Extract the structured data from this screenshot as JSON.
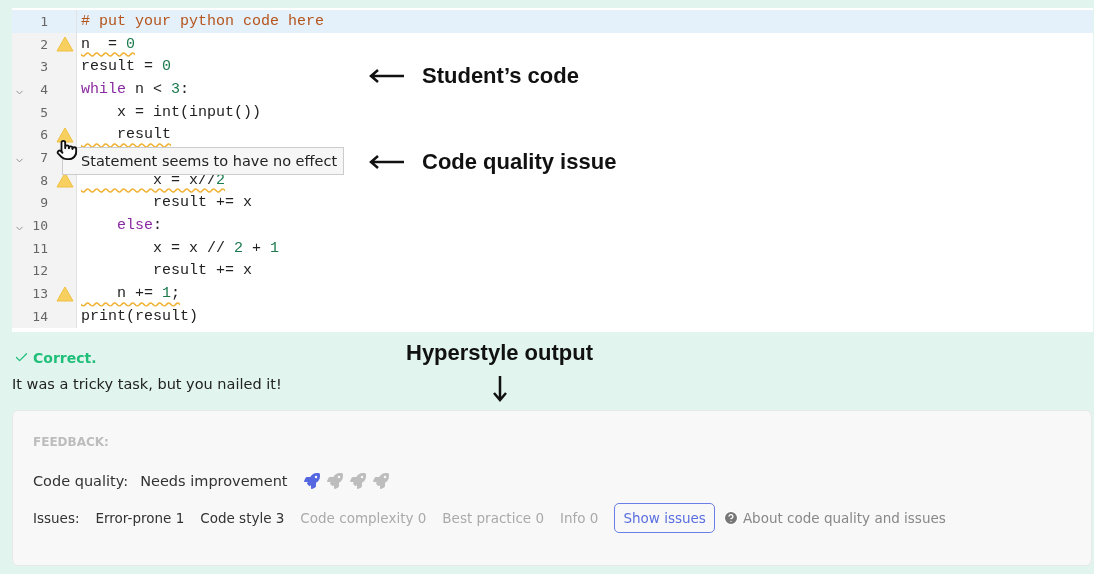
{
  "editor": {
    "lines": [
      {
        "number": "1",
        "selected": true,
        "foldable": false,
        "warning": false,
        "tokens": [
          {
            "kind": "comment",
            "text": "# put your python code here"
          }
        ]
      },
      {
        "number": "2",
        "selected": false,
        "foldable": false,
        "warning": true,
        "tokens": [
          {
            "kind": "plain",
            "text": "n  = "
          },
          {
            "kind": "number",
            "text": "0"
          }
        ]
      },
      {
        "number": "3",
        "selected": false,
        "foldable": false,
        "warning": false,
        "tokens": [
          {
            "kind": "plain",
            "text": "result = "
          },
          {
            "kind": "number",
            "text": "0"
          }
        ]
      },
      {
        "number": "4",
        "selected": false,
        "foldable": true,
        "warning": false,
        "tokens": [
          {
            "kind": "keyword",
            "text": "while"
          },
          {
            "kind": "plain",
            "text": " n < "
          },
          {
            "kind": "number",
            "text": "3"
          },
          {
            "kind": "plain",
            "text": ":"
          }
        ]
      },
      {
        "number": "5",
        "selected": false,
        "foldable": false,
        "warning": false,
        "tokens": [
          {
            "kind": "plain",
            "text": "    x = int(input())"
          }
        ]
      },
      {
        "number": "6",
        "selected": false,
        "foldable": false,
        "warning": true,
        "tokens": [
          {
            "kind": "plain",
            "text": "    result"
          }
        ]
      },
      {
        "number": "7",
        "selected": false,
        "foldable": true,
        "warning": false
      },
      {
        "number": "8",
        "selected": false,
        "foldable": false,
        "warning": true,
        "tokens": [
          {
            "kind": "plain",
            "text": "        x = x//"
          },
          {
            "kind": "number",
            "text": "2"
          }
        ]
      },
      {
        "number": "9",
        "selected": false,
        "foldable": false,
        "warning": false,
        "tokens": [
          {
            "kind": "plain",
            "text": "        result += x"
          }
        ]
      },
      {
        "number": "10",
        "selected": false,
        "foldable": true,
        "warning": false,
        "tokens": [
          {
            "kind": "keyword",
            "text": "    else"
          },
          {
            "kind": "plain",
            "text": ":"
          }
        ]
      },
      {
        "number": "11",
        "selected": false,
        "foldable": false,
        "warning": false,
        "tokens": [
          {
            "kind": "plain",
            "text": "        x = x // "
          },
          {
            "kind": "number",
            "text": "2"
          },
          {
            "kind": "plain",
            "text": " + "
          },
          {
            "kind": "number",
            "text": "1"
          }
        ]
      },
      {
        "number": "12",
        "selected": false,
        "foldable": false,
        "warning": false,
        "tokens": [
          {
            "kind": "plain",
            "text": "        result += x"
          }
        ]
      },
      {
        "number": "13",
        "selected": false,
        "foldable": false,
        "warning": true,
        "tokens": [
          {
            "kind": "plain",
            "text": "    n += "
          },
          {
            "kind": "number",
            "text": "1"
          },
          {
            "kind": "plain",
            "text": ";"
          }
        ]
      },
      {
        "number": "14",
        "selected": false,
        "foldable": false,
        "warning": false,
        "tokens": [
          {
            "kind": "plain",
            "text": "print(result)"
          }
        ]
      }
    ],
    "tooltip": "Statement seems to have no effect"
  },
  "annotations": [
    {
      "text": "Student’s code"
    },
    {
      "text": "Code quality issue"
    },
    {
      "text": "Hyperstyle output"
    }
  ],
  "result": {
    "status": "Correct.",
    "message": "It was a tricky task, but you nailed it!"
  },
  "feedback": {
    "heading": "FEEDBACK:",
    "quality_label": "Code quality:",
    "quality_value": "Needs improvement",
    "stars": 1,
    "issues_label": "Issues:",
    "issues": [
      {
        "label": "Error-prone 1",
        "active": true
      },
      {
        "label": "Code style 3",
        "active": true
      },
      {
        "label": "Code complexity 0",
        "active": false
      },
      {
        "label": "Best practice 0",
        "active": false
      },
      {
        "label": "Info 0",
        "active": false
      }
    ],
    "show_button": "Show issues",
    "help_link": "About code quality and issues"
  }
}
